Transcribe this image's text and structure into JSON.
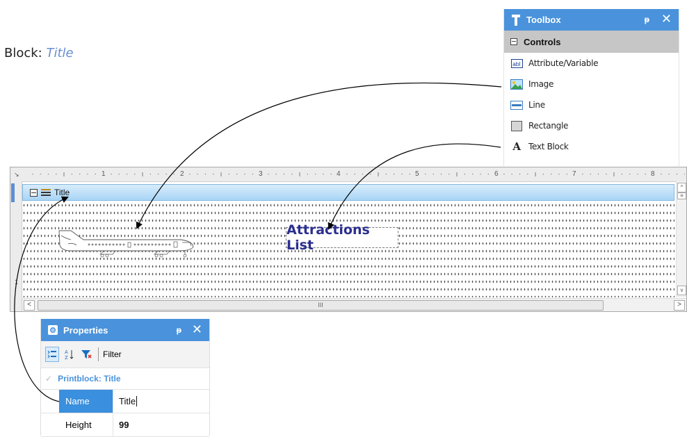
{
  "heading": {
    "prefix": "Block: ",
    "title": "Title"
  },
  "toolbox": {
    "title": "Toolbox",
    "pin_icon": "pin-icon",
    "close_label": "✕",
    "category": "Controls",
    "items": [
      {
        "label": "Attribute/Variable",
        "icon": "attribute-variable-icon"
      },
      {
        "label": "Image",
        "icon": "image-icon"
      },
      {
        "label": "Line",
        "icon": "line-icon"
      },
      {
        "label": "Rectangle",
        "icon": "rectangle-icon"
      },
      {
        "label": "Text Block",
        "icon": "text-block-icon"
      }
    ]
  },
  "designer": {
    "ruler_numbers": [
      "1",
      "2",
      "3",
      "4",
      "5",
      "6",
      "7",
      "8"
    ],
    "ruler_left_numbers": [
      "1"
    ],
    "section_title": "Title",
    "text_block": "Attractions List",
    "scroll_grip": "III",
    "scroll_left": "<",
    "scroll_right": ">"
  },
  "properties": {
    "title": "Properties",
    "close_label": "✕",
    "filter_label": "Filter",
    "category": "Printblock: Title",
    "rows": [
      {
        "key": "Name",
        "value": "Title"
      },
      {
        "key": "Height",
        "value": "99"
      }
    ]
  },
  "colors": {
    "panel_header": "#4a93dc",
    "section_bar": "#a9d5f6",
    "text_block": "#2b2f8f",
    "heading_accent": "#6a8fd0",
    "selected_row": "#3a8fde"
  }
}
